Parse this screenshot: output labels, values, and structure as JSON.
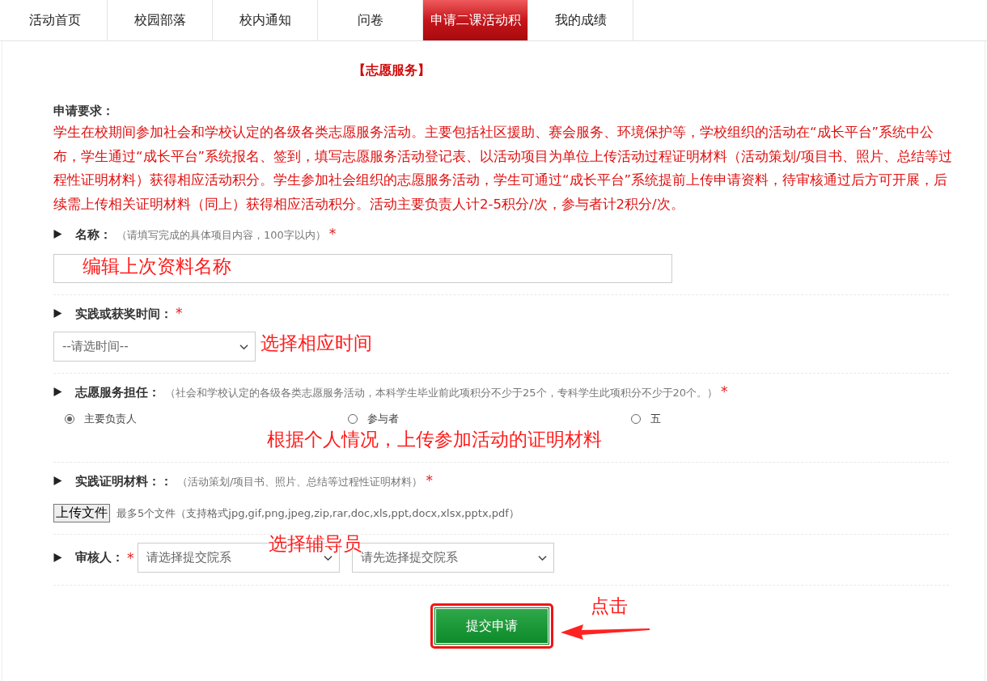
{
  "tabs": [
    {
      "label": "活动首页",
      "selected": false
    },
    {
      "label": "校园部落",
      "selected": false
    },
    {
      "label": "校内通知",
      "selected": false
    },
    {
      "label": "问卷",
      "selected": false
    },
    {
      "label": "申请二课活动积",
      "selected": true
    },
    {
      "label": "我的成绩",
      "selected": false
    }
  ],
  "title": "【志愿服务】",
  "requirements": {
    "heading": "申请要求：",
    "text": "学生在校期间参加社会和学校认定的各级各类志愿服务活动。主要包括社区援助、赛会服务、环境保护等，学校组织的活动在“成长平台”系统中公布，学生通过“成长平台”系统报名、签到，填写志愿服务活动登记表、以活动项目为单位上传活动过程证明材料（活动策划/项目书、照片、总结等过程性证明材料）获得相应活动积分。学生参加社会组织的志愿服务活动，学生可通过“成长平台”系统提前上传申请资料，待审核通过后方可开展，后续需上传相关证明材料（同上）获得相应活动积分。活动主要负责人计2-5积分/次，参与者计2积分/次。"
  },
  "fields": [
    {
      "kind": "text",
      "label": "名称：",
      "hint": "（请填写完成的具体项目内容，100字以内）",
      "required": "*",
      "note": "编辑上次资料名称"
    },
    {
      "kind": "select",
      "label": "实践或获奖时间：",
      "required": "*",
      "selects": [
        {
          "value": "--请选时间--"
        }
      ],
      "note": "选择相应时间"
    },
    {
      "kind": "radio",
      "label": "志愿服务担任：",
      "hint": "（社会和学校认定的各级各类志愿服务活动，本科学生毕业前此项积分不少于25个，专科学生此项积分不少于20个。）",
      "required": "*",
      "options": [
        {
          "label": "主要负责人",
          "selected": true
        },
        {
          "label": "参与者",
          "selected": false
        },
        {
          "label": "五",
          "selected": false
        }
      ],
      "note": "根据个人情况，上传参加活动的证明材料"
    },
    {
      "kind": "file",
      "label": "实践证明材料：：",
      "hint": "（活动策划/项目书、照片、总结等过程性证明材料）",
      "required": "*",
      "button": "上传文件",
      "info": "最多5个文件（支持格式jpg,gif,png,jpeg,zip,rar,doc,xls,ppt,docx,xlsx,pptx,pdf）"
    },
    {
      "kind": "reviewer",
      "label": "审核人：",
      "required": "*",
      "selects": [
        {
          "value": "请选择提交院系"
        },
        {
          "value": "请先选择提交院系"
        }
      ],
      "note": "选择辅导员"
    }
  ],
  "submit": {
    "label": "提交申请",
    "highlighted": true,
    "note": "点击"
  }
}
